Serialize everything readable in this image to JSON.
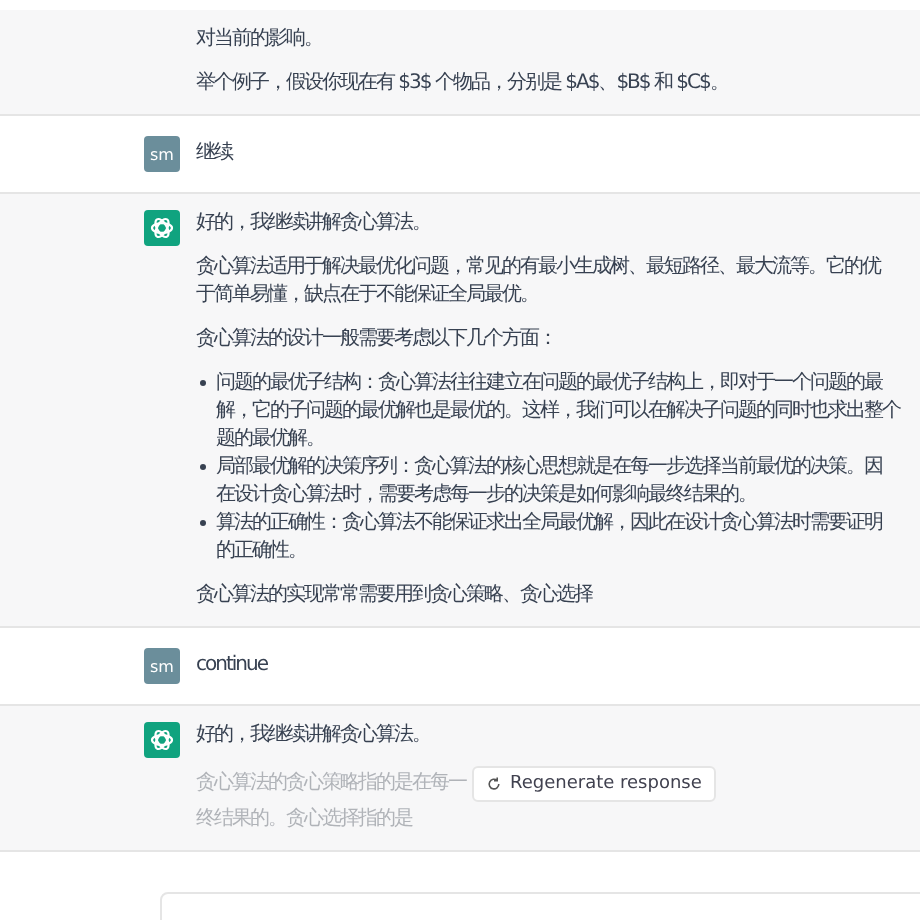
{
  "messages": [
    {
      "kind": "assistant",
      "avatar": false,
      "blocks": [
        {
          "kind": "p",
          "lines": [
            "对当前的影响。"
          ]
        },
        {
          "kind": "p",
          "lines": [
            "举个例子，假设你现在有 $3$ 个物品，分别是 $A$、$B$ 和 $C$。"
          ]
        }
      ]
    },
    {
      "kind": "user",
      "avatar_text": "sm",
      "text": "继续"
    },
    {
      "kind": "assistant",
      "avatar": true,
      "blocks": [
        {
          "kind": "p",
          "lines": [
            "好的，我继续讲解贪心算法。"
          ]
        },
        {
          "kind": "p",
          "lines": [
            "贪心算法适用于解决最优化问题，常见的有最小生成树、最短路径、最大流等。它的优",
            "于简单易懂，缺点在于不能保证全局最优。"
          ]
        },
        {
          "kind": "p",
          "lines": [
            "贪心算法的设计一般需要考虑以下几个方面："
          ]
        },
        {
          "kind": "list",
          "items": [
            {
              "lines": [
                "问题的最优子结构：贪心算法往往建立在问题的最优子结构上，即对于一个问题的最",
                "解，它的子问题的最优解也是最优的。这样，我们可以在解决子问题的同时也求出整个",
                "题的最优解。"
              ]
            },
            {
              "lines": [
                "局部最优解的决策序列：贪心算法的核心思想就是在每一步选择当前最优的决策。因",
                "在设计贪心算法时，需要考虑每一步的决策是如何影响最终结果的。"
              ]
            },
            {
              "lines": [
                "算法的正确性：贪心算法不能保证求出全局最优解，因此在设计贪心算法时需要证明",
                "的正确性。"
              ]
            }
          ]
        },
        {
          "kind": "p",
          "lines": [
            "贪心算法的实现常常需要用到贪心策略、贪心选择"
          ]
        }
      ]
    },
    {
      "kind": "user",
      "avatar_text": "sm",
      "text": "continue"
    },
    {
      "kind": "assistant",
      "avatar": true,
      "blocks": [
        {
          "kind": "p",
          "lines": [
            "好的，我继续讲解贪心算法。"
          ]
        },
        {
          "kind": "faded",
          "left": "贪心算法的贪心策略指的是在每一",
          "right": "终结果的。贪心选择指的是"
        }
      ]
    }
  ],
  "regenerate_button": "Regenerate response"
}
